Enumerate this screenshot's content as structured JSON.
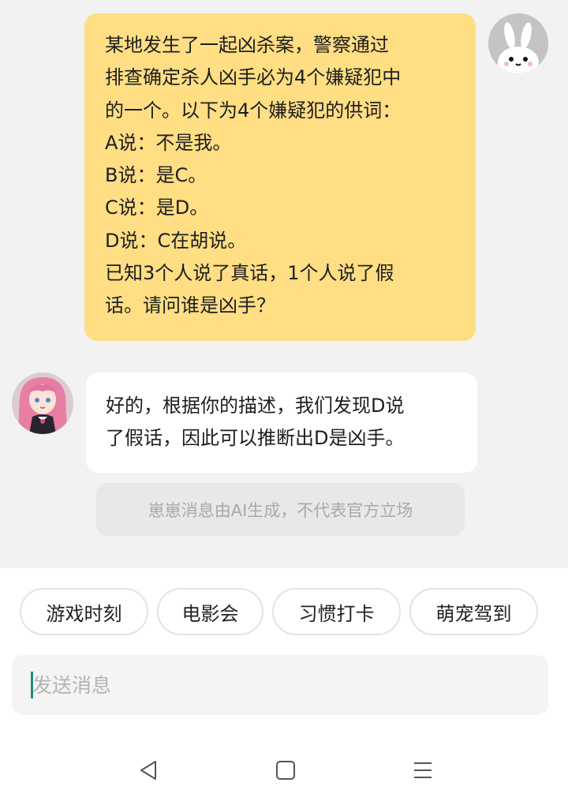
{
  "messages": {
    "user": {
      "lines": [
        "某地发生了一起凶杀案，警察通过",
        "排查确定杀人凶手必为4个嫌疑犯中",
        "的一个。以下为4个嫌疑犯的供词：",
        "A说：不是我。",
        "B说：是C。",
        "C说：是D。",
        "D说：C在胡说。",
        "已知3个人说了真话，1个人说了假",
        "话。请问谁是凶手？"
      ]
    },
    "bot": {
      "lines": [
        "好的，根据你的描述，我们发现D说",
        "了假话，因此可以推断出D是凶手。"
      ]
    },
    "disclaimer": "崽崽消息由AI生成，不代表官方立场"
  },
  "quick_actions": [
    "游戏时刻",
    "电影会",
    "习惯打卡",
    "萌宠驾到"
  ],
  "composer": {
    "placeholder": "发送消息",
    "value": ""
  },
  "nav": {
    "back": "back-icon",
    "home": "home-icon",
    "menu": "menu-icon"
  },
  "colors": {
    "user_bubble": "#ffde84",
    "bot_bubble": "#ffffff",
    "background": "#f2f2f2",
    "caret": "#1a8f7c"
  }
}
